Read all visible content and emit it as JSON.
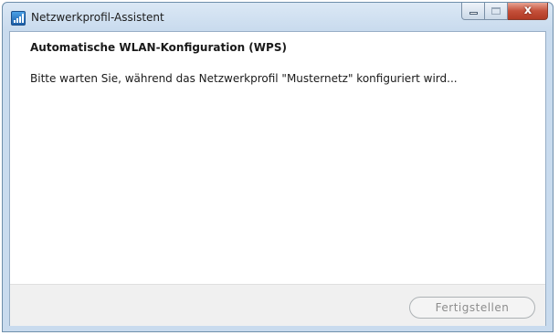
{
  "window": {
    "title": "Netzwerkprofil-Assistent",
    "icon": "network-wizard-icon",
    "caption": {
      "minimize_icon": "minimize-icon",
      "maximize_icon": "maximize-icon",
      "close_glyph": "x"
    }
  },
  "main": {
    "heading": "Automatische WLAN-Konfiguration (WPS)",
    "message": "Bitte warten Sie, während das Netzwerkprofil \"Musternetz\" konfiguriert wird..."
  },
  "footer": {
    "finish_label": "Fertigstellen",
    "finish_enabled": false
  },
  "colors": {
    "frame": "#c9dbee",
    "close_button": "#c4503a",
    "disabled_text": "#8d8d8d"
  }
}
